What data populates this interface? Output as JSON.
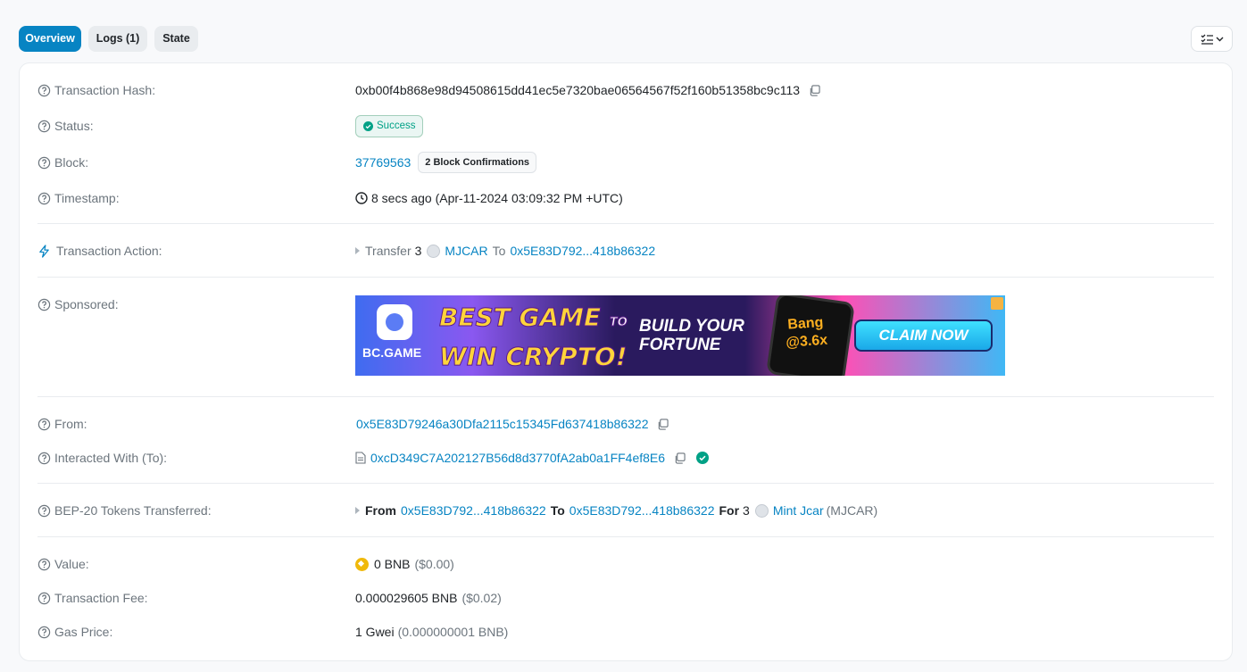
{
  "tabs": [
    {
      "label": "Overview",
      "active": true
    },
    {
      "label": "Logs (1)",
      "active": false
    },
    {
      "label": "State",
      "active": false
    }
  ],
  "rows": {
    "tx_hash": {
      "label": "Transaction Hash:",
      "value": "0xb00f4b868e98d94508615dd41ec5e7320bae06564567f52f160b51358bc9c113"
    },
    "status": {
      "label": "Status:",
      "value": "Success"
    },
    "block": {
      "label": "Block:",
      "value": "37769563",
      "confirmations": "2 Block Confirmations"
    },
    "timestamp": {
      "label": "Timestamp:",
      "value": "8 secs ago (Apr-11-2024 03:09:32 PM +UTC)"
    },
    "action": {
      "label": "Transaction Action:",
      "verb": "Transfer",
      "amount": "3",
      "token": "MJCAR",
      "to_word": "To",
      "to_addr": "0x5E83D792...418b86322"
    },
    "sponsored": {
      "label": "Sponsored:"
    },
    "from": {
      "label": "From:",
      "value": "0x5E83D79246a30Dfa2115c15345Fd637418b86322"
    },
    "interacted": {
      "label": "Interacted With (To):",
      "value": "0xcD349C7A202127B56d8d3770fA2ab0a1FF4ef8E6"
    },
    "tokens": {
      "label": "BEP-20 Tokens Transferred:",
      "from_word": "From",
      "from_addr": "0x5E83D792...418b86322",
      "to_word": "To",
      "to_addr": "0x5E83D792...418b86322",
      "for_word": "For",
      "amount": "3",
      "token_name": "Mint Jcar",
      "token_symbol": "(MJCAR)"
    },
    "value": {
      "label": "Value:",
      "amount": "0 BNB",
      "usd": "($0.00)"
    },
    "fee": {
      "label": "Transaction Fee:",
      "amount": "0.000029605 BNB",
      "usd": "($0.02)"
    },
    "gas": {
      "label": "Gas Price:",
      "amount": "1 Gwei",
      "detail": "(0.000000001 BNB)"
    }
  },
  "banner": {
    "brand": "BC.GAME",
    "line1": "BEST GAME",
    "to": "TO",
    "line2": "WIN CRYPTO!",
    "mid1": "BUILD YOUR",
    "mid2": "FORTUNE",
    "phone1": "Bang",
    "phone2": "@3.6x",
    "cta": "CLAIM NOW"
  },
  "colors": {
    "accent": "#0784c3",
    "success": "#00a186",
    "muted": "#6c757d"
  }
}
